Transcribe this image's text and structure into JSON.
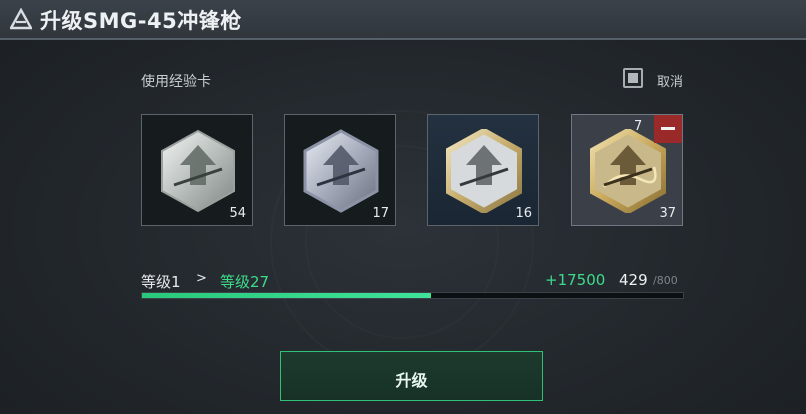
{
  "header": {
    "title": "升级SMG-45冲锋枪",
    "logo_icon": "triangle-logo-icon"
  },
  "section": {
    "label": "使用经验卡",
    "cancel_label": "取消"
  },
  "cards": [
    {
      "count": "54",
      "tier": "silver",
      "selected_count": ""
    },
    {
      "count": "17",
      "tier": "steel",
      "selected_count": ""
    },
    {
      "count": "16",
      "tier": "gold",
      "selected_count": ""
    },
    {
      "count": "37",
      "tier": "gold-premium",
      "selected_count": "7"
    }
  ],
  "level": {
    "current": "等级1",
    "arrow": ">",
    "next": "等级27",
    "exp_gain": "+17500",
    "exp_current": "429",
    "exp_max": "/800",
    "progress_fraction": 0.535
  },
  "actions": {
    "upgrade_label": "升级"
  },
  "colors": {
    "accent_green": "#3ddc8a",
    "minus_red": "#9a2a2a"
  }
}
